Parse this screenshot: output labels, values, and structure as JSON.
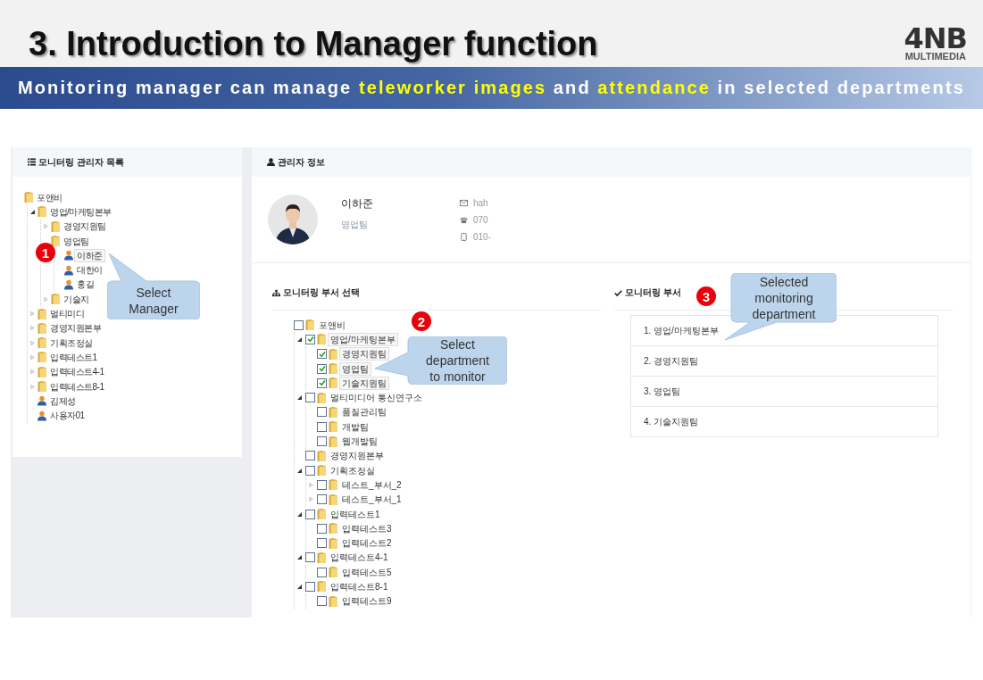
{
  "slide": {
    "title": "3. Introduction to Manager function",
    "logo": {
      "main": "4NB",
      "sub": "MULTIMEDIA"
    },
    "banner": [
      {
        "text": "Monitoring manager can manage ",
        "highlight": false
      },
      {
        "text": "teleworker images",
        "highlight": true
      },
      {
        "text": " and ",
        "highlight": false
      },
      {
        "text": "attendance",
        "highlight": true
      },
      {
        "text": " in selected departments",
        "highlight": false
      }
    ]
  },
  "manager_list": {
    "title": "모니터링 관리자 목록",
    "tree": [
      {
        "kind": "folder",
        "label": "포앤비",
        "selected": false,
        "children": [
          {
            "kind": "folder",
            "label": "영업/마케팅본부",
            "expanded": true,
            "selected": false,
            "children": [
              {
                "kind": "folder",
                "label": "경영지원팀",
                "expanded": false,
                "selected": false
              },
              {
                "kind": "folder",
                "label": "영업팀",
                "selected": false,
                "children": [
                  {
                    "kind": "person",
                    "label": "이하준",
                    "selected": true
                  },
                  {
                    "kind": "person",
                    "label": "대한이",
                    "selected": false
                  },
                  {
                    "kind": "person",
                    "label": "홍길",
                    "selected": false
                  }
                ]
              },
              {
                "kind": "folder",
                "label": "기술지",
                "expanded": false,
                "selected": false
              }
            ]
          },
          {
            "kind": "folder",
            "label": "멀티미디",
            "expanded": false,
            "selected": false
          },
          {
            "kind": "folder",
            "label": "경영지원본부",
            "expanded": false,
            "selected": false
          },
          {
            "kind": "folder",
            "label": "기획조정실",
            "expanded": false,
            "selected": false
          },
          {
            "kind": "folder",
            "label": "입력테스트1",
            "expanded": false,
            "selected": false
          },
          {
            "kind": "folder",
            "label": "입력테스트4-1",
            "expanded": false,
            "selected": false
          },
          {
            "kind": "folder",
            "label": "입력테스트8-1",
            "expanded": false,
            "selected": false
          },
          {
            "kind": "person",
            "label": "김제성",
            "selected": false
          },
          {
            "kind": "person",
            "label": "사용자01",
            "selected": false
          }
        ]
      }
    ]
  },
  "manager_info": {
    "title": "관리자 정보",
    "name": "이하준",
    "department": "영업팀",
    "contacts": [
      {
        "kind": "email",
        "value": "hah"
      },
      {
        "kind": "phone",
        "value": "070"
      },
      {
        "kind": "mobile",
        "value": "010-"
      }
    ]
  },
  "department_select": {
    "title": "모니터링 부서 선택",
    "tree": [
      {
        "kind": "folder",
        "label": "포앤비",
        "checked": false,
        "selected": false,
        "children": [
          {
            "kind": "folder",
            "label": "영업/마케팅본부",
            "expanded": true,
            "checked": true,
            "selected": true,
            "children": [
              {
                "kind": "folder",
                "label": "경영지원팀",
                "checked": true,
                "selected": true
              },
              {
                "kind": "folder",
                "label": "영업팀",
                "checked": true,
                "selected": true
              },
              {
                "kind": "folder",
                "label": "기술지원팀",
                "checked": true,
                "selected": true
              }
            ]
          },
          {
            "kind": "folder",
            "label": "멀티미디어 통신연구소",
            "expanded": true,
            "checked": false,
            "selected": false,
            "children": [
              {
                "kind": "folder",
                "label": "품질관리팀",
                "checked": false,
                "selected": false
              },
              {
                "kind": "folder",
                "label": "개발팀",
                "checked": false,
                "selected": false
              },
              {
                "kind": "folder",
                "label": "웹개발팀",
                "checked": false,
                "selected": false
              }
            ]
          },
          {
            "kind": "folder",
            "label": "경영지원본부",
            "checked": false,
            "selected": false
          },
          {
            "kind": "folder",
            "label": "기획조정실",
            "expanded": true,
            "checked": false,
            "selected": false,
            "children": [
              {
                "kind": "folder",
                "label": "테스트_부서_2",
                "expanded": false,
                "checked": false,
                "selected": false
              },
              {
                "kind": "folder",
                "label": "테스트_부서_1",
                "expanded": false,
                "checked": false,
                "selected": false
              }
            ]
          },
          {
            "kind": "folder",
            "label": "입력테스트1",
            "expanded": true,
            "checked": false,
            "selected": false,
            "children": [
              {
                "kind": "folder",
                "label": "입력테스트3",
                "checked": false,
                "selected": false
              },
              {
                "kind": "folder",
                "label": "입력테스트2",
                "checked": false,
                "selected": false
              }
            ]
          },
          {
            "kind": "folder",
            "label": "입력테스트4-1",
            "expanded": true,
            "checked": false,
            "selected": false,
            "children": [
              {
                "kind": "folder",
                "label": "입력테스트5",
                "checked": false,
                "selected": false
              }
            ]
          },
          {
            "kind": "folder",
            "label": "입력테스트8-1",
            "expanded": true,
            "checked": false,
            "selected": false,
            "children": [
              {
                "kind": "folder",
                "label": "입력테스트9",
                "checked": false,
                "selected": false
              }
            ]
          }
        ]
      }
    ]
  },
  "monitored_departments": {
    "title": "모니터링 부서",
    "items": [
      "1. 영업/마케팅본부",
      "2. 경영지원팀",
      "3. 영업팀",
      "4. 기술지원팀"
    ]
  },
  "callouts": [
    {
      "number": "1",
      "text": "Select\nManager"
    },
    {
      "number": "2",
      "text": "Select\ndepartment\nto monitor"
    },
    {
      "number": "3",
      "text": "Selected\nmonitoring\ndepartment"
    }
  ]
}
